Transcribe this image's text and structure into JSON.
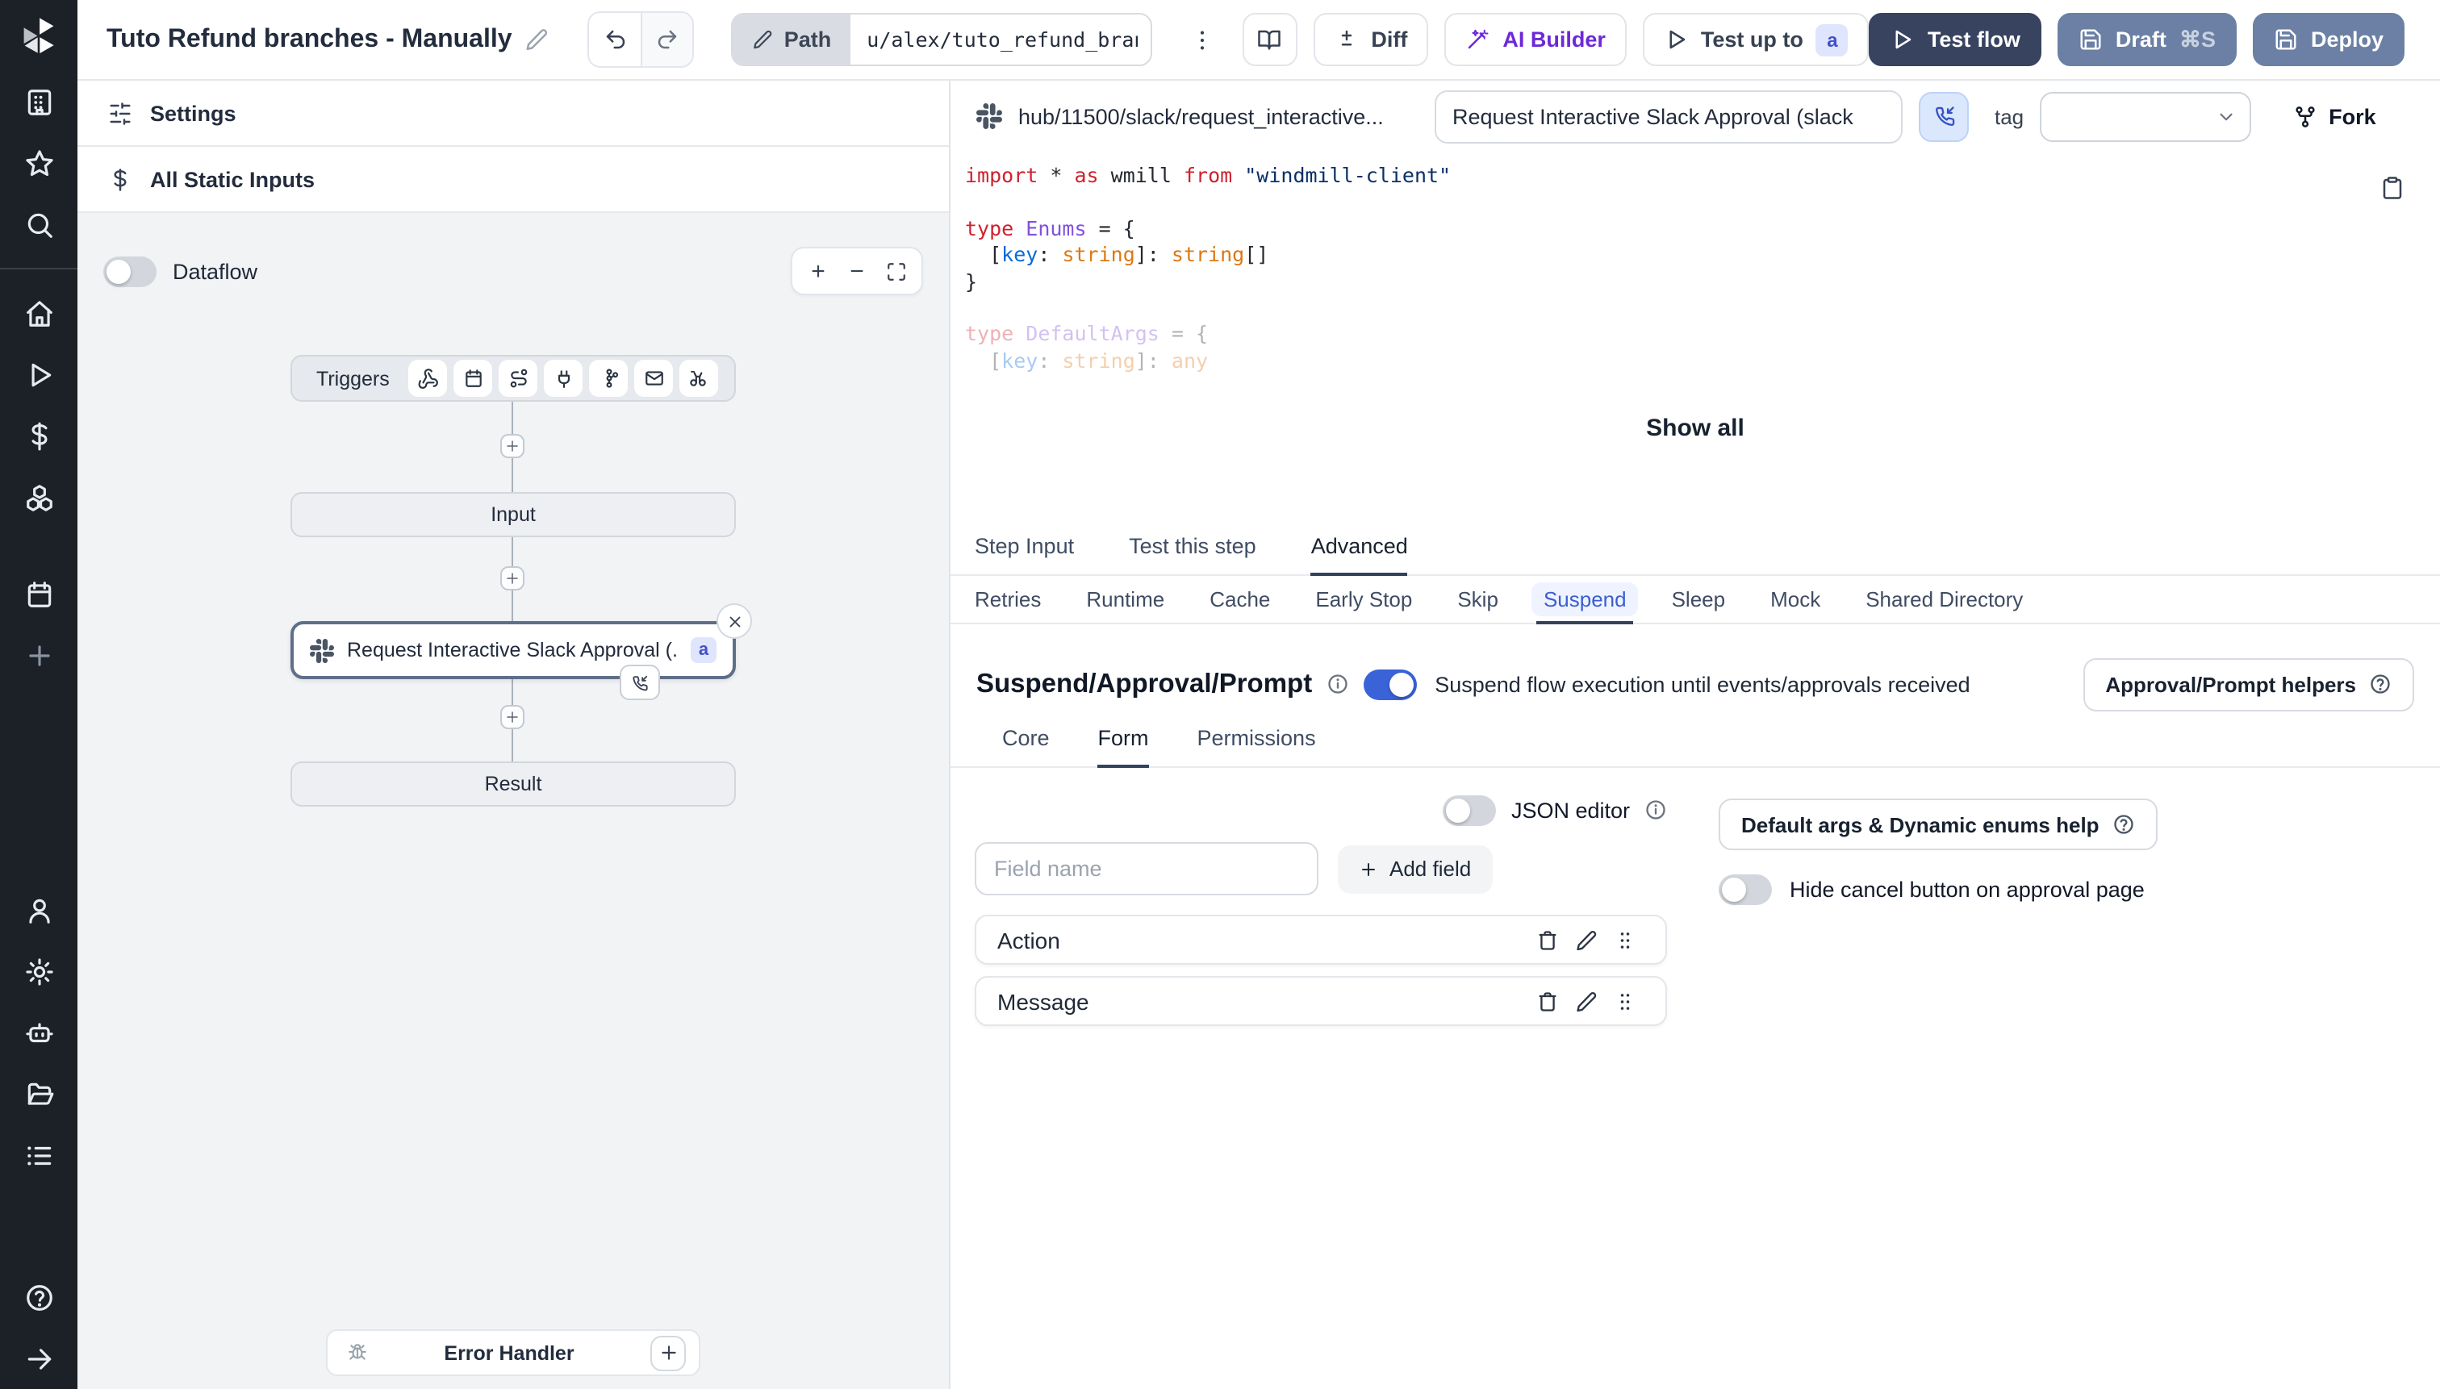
{
  "topbar": {
    "title": "Tuto Refund branches - Manually",
    "path_label": "Path",
    "path_value": "u/alex/tuto_refund_branches__",
    "diff_label": "Diff",
    "ai_builder_label": "AI Builder",
    "test_up_to_label": "Test up to",
    "test_up_to_badge": "a",
    "test_flow_label": "Test flow",
    "draft_label": "Draft",
    "draft_shortcut": "⌘S",
    "deploy_label": "Deploy"
  },
  "colors": {
    "accent_blue": "#3b63d8",
    "ai_purple": "#6d28d9",
    "test_flow_navy": "#384360",
    "draft_deploy_slate": "#6b80a4",
    "badge_indigo": "#4250c9",
    "suspend_tab_blue": "#3b5fd0"
  },
  "flow": {
    "settings_label": "Settings",
    "all_static_inputs_label": "All Static Inputs",
    "dataflow_label": "Dataflow",
    "zoom_in": "+",
    "zoom_out": "−",
    "triggers_label": "Triggers",
    "input_node": "Input",
    "step_node_label": "Request Interactive Slack Approval (...",
    "step_node_badge": "a",
    "result_node": "Result",
    "error_handler_label": "Error Handler"
  },
  "header": {
    "hub_path": "hub/11500/slack/request_interactive...",
    "summary_value": "Request Interactive Slack Approval (slack",
    "tag_label": "tag",
    "fork_label": "Fork"
  },
  "code": {
    "l1": [
      "import",
      " * ",
      "as",
      " wmill ",
      "from",
      " \"windmill-client\""
    ],
    "l3": [
      "type",
      " Enums",
      " = {"
    ],
    "l4": [
      "  [",
      "key",
      ": ",
      "string",
      "]: ",
      "string",
      "[]"
    ],
    "l5": "}",
    "l7": [
      "type",
      " DefaultArgs",
      " = {"
    ],
    "l8": [
      "  [",
      "key",
      ": ",
      "string",
      "]: ",
      "any"
    ],
    "show_all": "Show all"
  },
  "tabs": {
    "items": [
      {
        "label": "Step Input"
      },
      {
        "label": "Test this step"
      },
      {
        "label": "Advanced"
      }
    ]
  },
  "advanced_tabs": {
    "items": [
      "Retries",
      "Runtime",
      "Cache",
      "Early Stop",
      "Skip",
      "Suspend",
      "Sleep",
      "Mock",
      "Shared Directory"
    ]
  },
  "suspend": {
    "title": "Suspend/Approval/Prompt",
    "toggle_description": "Suspend flow execution until events/approvals received",
    "helpers_button": "Approval/Prompt helpers",
    "sub_tabs": [
      "Core",
      "Form",
      "Permissions"
    ],
    "json_editor_label": "JSON editor",
    "field_name_placeholder": "Field name",
    "add_field_label": "Add field",
    "default_args_help_label": "Default args & Dynamic enums help",
    "hide_cancel_label": "Hide cancel button on approval page",
    "fields": [
      "Action",
      "Message"
    ]
  }
}
